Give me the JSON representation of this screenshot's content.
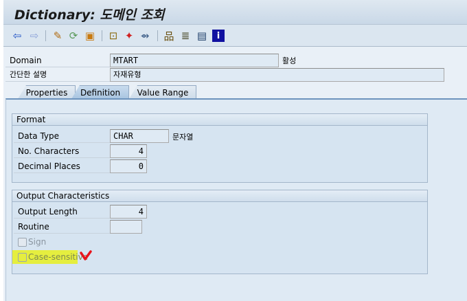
{
  "title": "Dictionary: 도메인 조회",
  "toolbar": {
    "icons": [
      "back-icon",
      "forward-icon",
      "display-change-icon",
      "active-inactive-icon",
      "other-object-icon",
      "where-used-icon",
      "activate-icon",
      "navigate-icon",
      "hierarchy-icon",
      "print-icon",
      "list-icon",
      "info-icon"
    ]
  },
  "header": {
    "domain_label": "Domain",
    "domain_value": "MTART",
    "domain_status": "활성",
    "desc_label": "간단한 설명",
    "desc_value": "자재유형"
  },
  "tabs": [
    {
      "label": "Properties"
    },
    {
      "label": "Definition",
      "active": true
    },
    {
      "label": "Value Range"
    }
  ],
  "format": {
    "title": "Format",
    "data_type_label": "Data Type",
    "data_type_value": "CHAR",
    "data_type_desc": "문자열",
    "no_chars_label": "No. Characters",
    "no_chars_value": "4",
    "decimals_label": "Decimal Places",
    "decimals_value": "0"
  },
  "output": {
    "title": "Output Characteristics",
    "length_label": "Output Length",
    "length_value": "4",
    "routine_label": "Routine",
    "routine_value": "",
    "sign_label": "Sign",
    "sign_checked": false,
    "case_label": "Case-sensitive",
    "case_checked": false
  },
  "colors": {
    "highlight": "#e8f020",
    "check_mark": "#e8141c"
  }
}
